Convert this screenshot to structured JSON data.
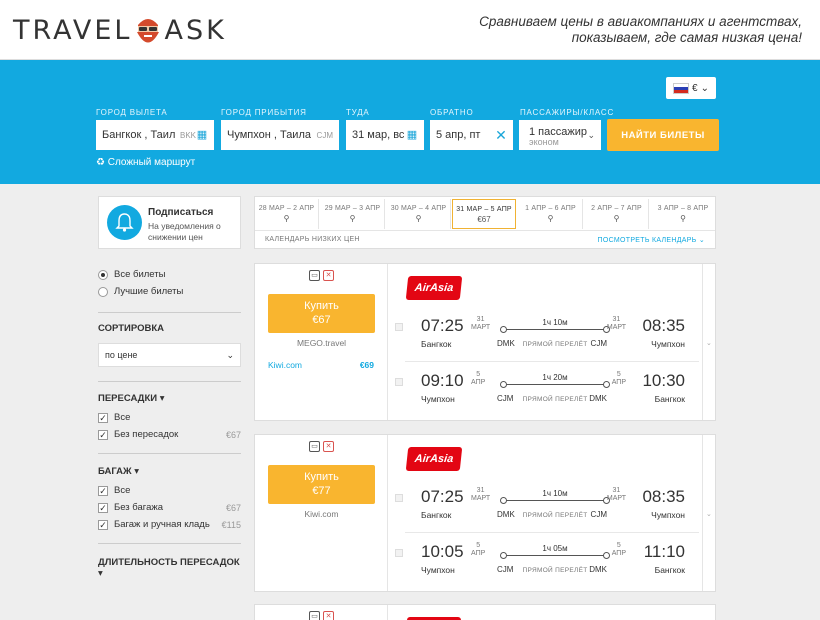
{
  "header": {
    "logo_word1": "TRAVEL",
    "logo_word2": "ASK",
    "tagline_line1": "Сравниваем цены в авиакомпаниях и агентствах,",
    "tagline_line2": "показываем, где самая низкая цена!"
  },
  "search": {
    "currency": "€",
    "labels": {
      "from": "ГОРОД ВЫЛЕТА",
      "to": "ГОРОД ПРИБЫТИЯ",
      "depart": "ТУДА",
      "return": "ОБРАТНО",
      "passengers": "ПАССАЖИРЫ/КЛАСС"
    },
    "from_value": "Бангкок , Таил",
    "from_code": "BKK",
    "to_value": "Чумпхон , Таила",
    "to_code": "CJM",
    "depart_value": "31 мар, вс",
    "return_value": "5 апр, пт",
    "passengers_value": "1 пассажир",
    "class_value": "эконом",
    "find_button": "НАЙТИ БИЛЕТЫ",
    "complex_route": "Сложный маршрут"
  },
  "subscribe": {
    "title": "Подписаться",
    "text": "На уведомления о снижении цен"
  },
  "calendar": {
    "cells": [
      {
        "dates": "28 МАР – 2 АПР",
        "price": ""
      },
      {
        "dates": "29 МАР – 3 АПР",
        "price": ""
      },
      {
        "dates": "30 МАР – 4 АПР",
        "price": ""
      },
      {
        "dates": "31 МАР – 5 АПР",
        "price": "€67"
      },
      {
        "dates": "1 АПР – 6 АПР",
        "price": ""
      },
      {
        "dates": "2 АПР – 7 АПР",
        "price": ""
      },
      {
        "dates": "3 АПР – 8 АПР",
        "price": ""
      }
    ],
    "footer": "КАЛЕНДАРЬ НИЗКИХ ЦЕН",
    "link": "ПОСМОТРЕТЬ КАЛЕНДАРЬ"
  },
  "sidebar": {
    "radio_all": "Все билеты",
    "radio_best": "Лучшие билеты",
    "sort_title": "СОРТИРОВКА",
    "sort_value": "по цене",
    "transfers_title": "ПЕРЕСАДКИ",
    "transfers_all": "Все",
    "transfers_none": "Без пересадок",
    "transfers_none_price": "€67",
    "baggage_title": "БАГАЖ",
    "baggage_all": "Все",
    "baggage_none": "Без багажа",
    "baggage_none_price": "€67",
    "baggage_hand": "Багаж и ручная кладь",
    "baggage_hand_price": "€115",
    "duration_title": "ДЛИТЕЛЬНОСТЬ ПЕРЕСАДОК"
  },
  "results": [
    {
      "buy_label": "Купить",
      "price": "€67",
      "agent": "MEGO.travel",
      "alt_agent": "Kiwi.com",
      "alt_price": "€69",
      "airline": "AirAsia",
      "out": {
        "dep_time": "07:25",
        "dep_day": "31",
        "dep_month": "МАРТ",
        "arr_time": "08:35",
        "arr_day": "31",
        "arr_month": "МАРТ",
        "dep_city": "Бангкок",
        "arr_city": "Чумпхон",
        "dep_code": "DMK",
        "arr_code": "CJM",
        "duration": "1ч 10м",
        "nonstop": "ПРЯМОЙ ПЕРЕЛЁТ"
      },
      "back": {
        "dep_time": "09:10",
        "dep_day": "5",
        "dep_month": "АПР",
        "arr_time": "10:30",
        "arr_day": "5",
        "arr_month": "АПР",
        "dep_city": "Чумпхон",
        "arr_city": "Бангкок",
        "dep_code": "CJM",
        "arr_code": "DMK",
        "duration": "1ч 20м",
        "nonstop": "ПРЯМОЙ ПЕРЕЛЁТ"
      }
    },
    {
      "buy_label": "Купить",
      "price": "€77",
      "agent": "Kiwi.com",
      "airline": "AirAsia",
      "out": {
        "dep_time": "07:25",
        "dep_day": "31",
        "dep_month": "МАРТ",
        "arr_time": "08:35",
        "arr_day": "31",
        "arr_month": "МАРТ",
        "dep_city": "Бангкок",
        "arr_city": "Чумпхон",
        "dep_code": "DMK",
        "arr_code": "CJM",
        "duration": "1ч 10м",
        "nonstop": "ПРЯМОЙ ПЕРЕЛЁТ"
      },
      "back": {
        "dep_time": "10:05",
        "dep_day": "5",
        "dep_month": "АПР",
        "arr_time": "11:10",
        "arr_day": "5",
        "arr_month": "АПР",
        "dep_city": "Чумпхон",
        "arr_city": "Бангкок",
        "dep_code": "CJM",
        "arr_code": "DMK",
        "duration": "1ч 05м",
        "nonstop": "ПРЯМОЙ ПЕРЕЛЁТ"
      }
    }
  ],
  "colors": {
    "brand_blue": "#12a9e0",
    "cta_orange": "#f9b52f",
    "airline_red": "#e30613"
  }
}
